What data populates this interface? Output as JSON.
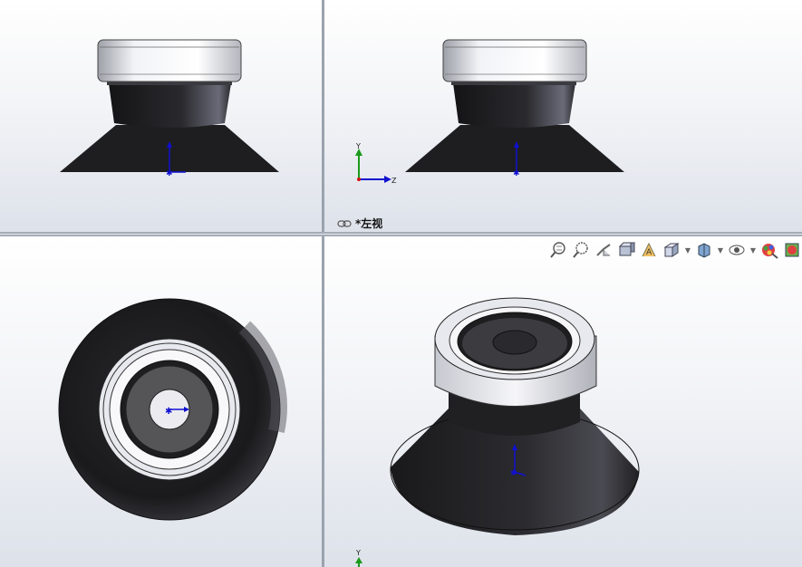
{
  "views": {
    "top_left": {
      "name": "front-view"
    },
    "top_right": {
      "name": "left-view",
      "label": "*左视",
      "label_icon": "link-icon"
    },
    "bottom_left": {
      "name": "top-view"
    },
    "bottom_right": {
      "name": "isometric-view"
    }
  },
  "triad": {
    "x": "Z",
    "y": "Y"
  },
  "toolbar": {
    "icons": [
      "zoom-to-fit-icon",
      "zoom-area-icon",
      "previous-view-icon",
      "section-view-icon",
      "dynamic-annotation-icon",
      "view-orientation-icon",
      "display-style-icon",
      "hide-show-items-icon",
      "edit-appearance-icon",
      "apply-scene-icon"
    ]
  },
  "colors": {
    "body_dark": "#1e1e20",
    "cap_light": "#e8e9ee",
    "axis_blue": "#1010d0",
    "axis_green": "#1a9a1a",
    "axis_red": "#d01010"
  }
}
